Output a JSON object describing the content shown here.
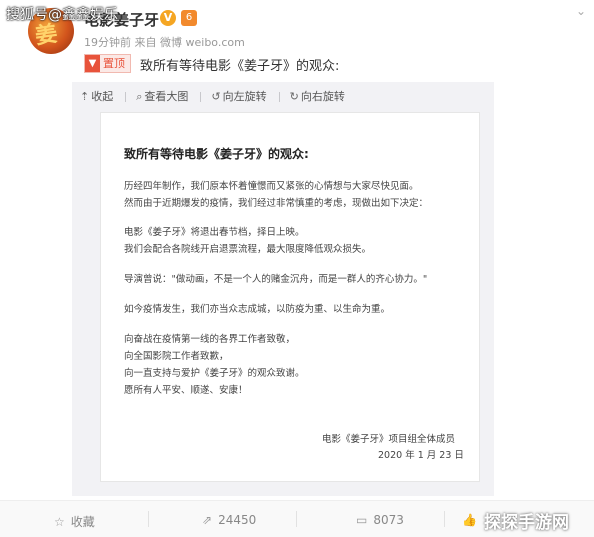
{
  "watermark": {
    "source": "搜狐号@鑫鑫娱乐",
    "site": "探探手游网"
  },
  "account": {
    "name": "电影姜子牙",
    "verified_glyph": "V",
    "rank_glyph": "6",
    "avatar_glyph": "姜"
  },
  "post": {
    "time": "19分钟前",
    "from_prefix": "来自",
    "source": "微博 weibo.com",
    "pinned_label": "置顶",
    "text": "致所有等待电影《姜子牙》的观众:"
  },
  "media_toolbar": {
    "collapse": "收起",
    "view_large": "查看大图",
    "rotate_left": "向左旋转",
    "rotate_right": "向右旋转"
  },
  "letter": {
    "title": "致所有等待电影《姜子牙》的观众:",
    "lines": [
      "历经四年制作，我们原本怀着憧憬而又紧张的心情想与大家尽快见面。",
      "然而由于近期爆发的疫情，我们经过非常慎重的考虑，现做出如下决定：",
      "电影《姜子牙》将退出春节档，择日上映。",
      "我们会配合各院线开启退票流程，最大限度降低观众损失。",
      "导演曾说：\"做动画，不是一个人的赌金沉舟，而是一群人的齐心协力。\"",
      "如今疫情发生，我们亦当众志成城，以防疫为重、以生命为重。",
      "向奋战在疫情第一线的各界工作者致敬，",
      "向全国影院工作者致歉，",
      "向一直支持与爱护《姜子牙》的观众致谢。",
      "愿所有人平安、顺遂、安康！"
    ],
    "signature": "电影《姜子牙》项目组全体成员",
    "date": "2020 年 1 月 23 日"
  },
  "footer": {
    "favorite": "收藏",
    "repost_count": "24450",
    "comment_count": "8073"
  }
}
